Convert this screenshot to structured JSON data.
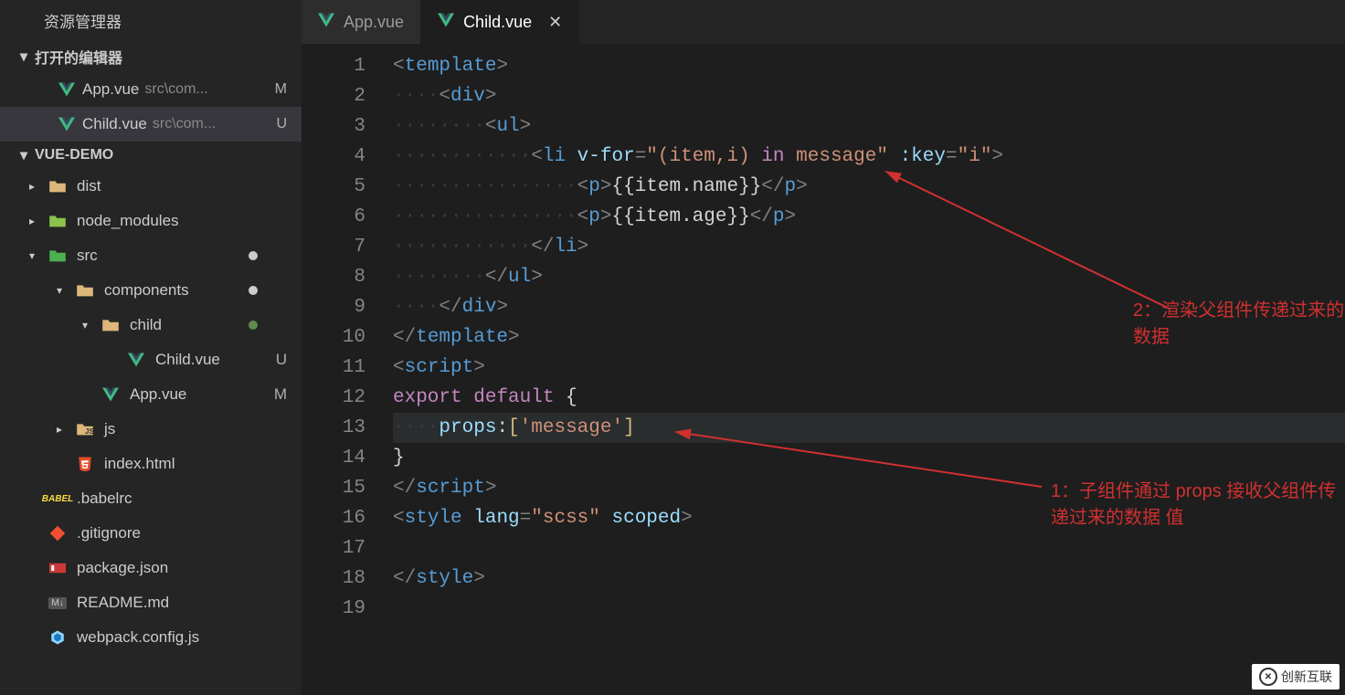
{
  "sidebar": {
    "title": "资源管理器",
    "openEditorsLabel": "打开的编辑器",
    "openEditors": [
      {
        "name": "App.vue",
        "path": "src\\com...",
        "badge": "M"
      },
      {
        "name": "Child.vue",
        "path": "src\\com...",
        "badge": "U"
      }
    ],
    "projectLabel": "VUE-DEMO",
    "tree": [
      {
        "type": "folder-closed",
        "name": "dist",
        "indent": 1,
        "icon": "folder-dist"
      },
      {
        "type": "folder-closed",
        "name": "node_modules",
        "indent": 1,
        "icon": "folder-node"
      },
      {
        "type": "folder-open",
        "name": "src",
        "indent": 1,
        "icon": "folder-src",
        "dot": true
      },
      {
        "type": "folder-open",
        "name": "components",
        "indent": 2,
        "icon": "folder-comp",
        "dot": true
      },
      {
        "type": "folder-open",
        "name": "child",
        "indent": 3,
        "icon": "folder",
        "dot": true,
        "dotColor": "#608b4e"
      },
      {
        "type": "file",
        "name": "Child.vue",
        "indent": 4,
        "icon": "vue",
        "badge": "U"
      },
      {
        "type": "file",
        "name": "App.vue",
        "indent": 3,
        "icon": "vue",
        "badge": "M"
      },
      {
        "type": "folder-closed",
        "name": "js",
        "indent": 2,
        "icon": "folder-js"
      },
      {
        "type": "file",
        "name": "index.html",
        "indent": 2,
        "icon": "html"
      },
      {
        "type": "file",
        "name": "‎.babelrc",
        "indent": 1,
        "icon": "babel"
      },
      {
        "type": "file",
        "name": "‎.gitignore",
        "indent": 1,
        "icon": "git"
      },
      {
        "type": "file",
        "name": "package.json",
        "indent": 1,
        "icon": "npm"
      },
      {
        "type": "file",
        "name": "README.md",
        "indent": 1,
        "icon": "md"
      },
      {
        "type": "file",
        "name": "webpack.config.js",
        "indent": 1,
        "icon": "webpack"
      }
    ]
  },
  "tabs": [
    {
      "name": "App.vue",
      "active": false
    },
    {
      "name": "Child.vue",
      "active": true
    }
  ],
  "lineCount": 19,
  "annotations": {
    "a1": "2：渲染父组件传递过来的数据",
    "a2": "1：子组件通过 props 接收父组件传递过来的数据 值"
  },
  "watermark": "创新互联",
  "source_code": "<template>\n    <div>\n        <ul>\n            <li v-for=\"(item,i) in message\" :key=\"i\">\n                <p>{{item.name}}</p>\n                <p>{{item.age}}</p>\n            </li>\n        </ul>\n    </div>\n</template>\n<script>\nexport default {\n    props:['message']\n}\n</script>\n<style lang=\"scss\" scoped>\n\n</style>\n",
  "code_tokens": {
    "l1": [
      {
        "t": "<",
        "c": "tag-b"
      },
      {
        "t": "template",
        "c": "tag-blue"
      },
      {
        "t": ">",
        "c": "tag-b"
      }
    ],
    "l2": [
      {
        "t": "····",
        "c": "ws"
      },
      {
        "t": "<",
        "c": "tag-b"
      },
      {
        "t": "div",
        "c": "tag-blue"
      },
      {
        "t": ">",
        "c": "tag-b"
      }
    ],
    "l3": [
      {
        "t": "········",
        "c": "ws"
      },
      {
        "t": "<",
        "c": "tag-b"
      },
      {
        "t": "ul",
        "c": "tag-blue"
      },
      {
        "t": ">",
        "c": "tag-b"
      }
    ],
    "l4": [
      {
        "t": "············",
        "c": "ws"
      },
      {
        "t": "<",
        "c": "tag-b"
      },
      {
        "t": "li",
        "c": "tag-blue"
      },
      {
        "t": " ",
        "c": "ws"
      },
      {
        "t": "v-for",
        "c": "attr"
      },
      {
        "t": "=",
        "c": "tag-b"
      },
      {
        "t": "\"(item,i) ",
        "c": "str"
      },
      {
        "t": "in",
        "c": "kw-red"
      },
      {
        "t": " message\"",
        "c": "str"
      },
      {
        "t": " ",
        "c": "ws"
      },
      {
        "t": ":key",
        "c": "attr"
      },
      {
        "t": "=",
        "c": "tag-b"
      },
      {
        "t": "\"i\"",
        "c": "str"
      },
      {
        "t": ">",
        "c": "tag-b"
      }
    ],
    "l5": [
      {
        "t": "················",
        "c": "ws"
      },
      {
        "t": "<",
        "c": "tag-b"
      },
      {
        "t": "p",
        "c": "tag-blue"
      },
      {
        "t": ">",
        "c": "tag-b"
      },
      {
        "t": "{{item.name}}",
        "c": ""
      },
      {
        "t": "</",
        "c": "tag-b"
      },
      {
        "t": "p",
        "c": "tag-blue"
      },
      {
        "t": ">",
        "c": "tag-b"
      }
    ],
    "l6": [
      {
        "t": "················",
        "c": "ws"
      },
      {
        "t": "<",
        "c": "tag-b"
      },
      {
        "t": "p",
        "c": "tag-blue"
      },
      {
        "t": ">",
        "c": "tag-b"
      },
      {
        "t": "{{item.age}}",
        "c": ""
      },
      {
        "t": "</",
        "c": "tag-b"
      },
      {
        "t": "p",
        "c": "tag-blue"
      },
      {
        "t": ">",
        "c": "tag-b"
      }
    ],
    "l7": [
      {
        "t": "············",
        "c": "ws"
      },
      {
        "t": "</",
        "c": "tag-b"
      },
      {
        "t": "li",
        "c": "tag-blue"
      },
      {
        "t": ">",
        "c": "tag-b"
      }
    ],
    "l8": [
      {
        "t": "········",
        "c": "ws"
      },
      {
        "t": "</",
        "c": "tag-b"
      },
      {
        "t": "ul",
        "c": "tag-blue"
      },
      {
        "t": ">",
        "c": "tag-b"
      }
    ],
    "l9": [
      {
        "t": "····",
        "c": "ws"
      },
      {
        "t": "</",
        "c": "tag-b"
      },
      {
        "t": "div",
        "c": "tag-blue"
      },
      {
        "t": ">",
        "c": "tag-b"
      }
    ],
    "l10": [
      {
        "t": "</",
        "c": "tag-b"
      },
      {
        "t": "template",
        "c": "tag-blue"
      },
      {
        "t": ">",
        "c": "tag-b"
      }
    ],
    "l11": [
      {
        "t": "<",
        "c": "tag-b"
      },
      {
        "t": "script",
        "c": "tag-blue"
      },
      {
        "t": ">",
        "c": "tag-b"
      }
    ],
    "l12": [
      {
        "t": "export",
        "c": "kw-red"
      },
      {
        "t": " ",
        "c": ""
      },
      {
        "t": "default",
        "c": "kw-red"
      },
      {
        "t": " {",
        "c": ""
      }
    ],
    "l13": [
      {
        "t": "····",
        "c": "ws"
      },
      {
        "t": "props",
        "c": "ident"
      },
      {
        "t": ":",
        "c": ""
      },
      {
        "t": "[",
        "c": "osq"
      },
      {
        "t": "'message'",
        "c": "str"
      },
      {
        "t": "]",
        "c": "osq"
      }
    ],
    "l14": [
      {
        "t": "}",
        "c": ""
      }
    ],
    "l15": [
      {
        "t": "</",
        "c": "tag-b"
      },
      {
        "t": "script",
        "c": "tag-blue"
      },
      {
        "t": ">",
        "c": "tag-b"
      }
    ],
    "l16": [
      {
        "t": "<",
        "c": "tag-b"
      },
      {
        "t": "style",
        "c": "tag-blue"
      },
      {
        "t": " ",
        "c": "ws"
      },
      {
        "t": "lang",
        "c": "attr"
      },
      {
        "t": "=",
        "c": "tag-b"
      },
      {
        "t": "\"scss\"",
        "c": "str"
      },
      {
        "t": " ",
        "c": "ws"
      },
      {
        "t": "scoped",
        "c": "attr"
      },
      {
        "t": ">",
        "c": "tag-b"
      }
    ],
    "l17": [],
    "l18": [
      {
        "t": "</",
        "c": "tag-b"
      },
      {
        "t": "style",
        "c": "tag-blue"
      },
      {
        "t": ">",
        "c": "tag-b"
      }
    ],
    "l19": []
  }
}
